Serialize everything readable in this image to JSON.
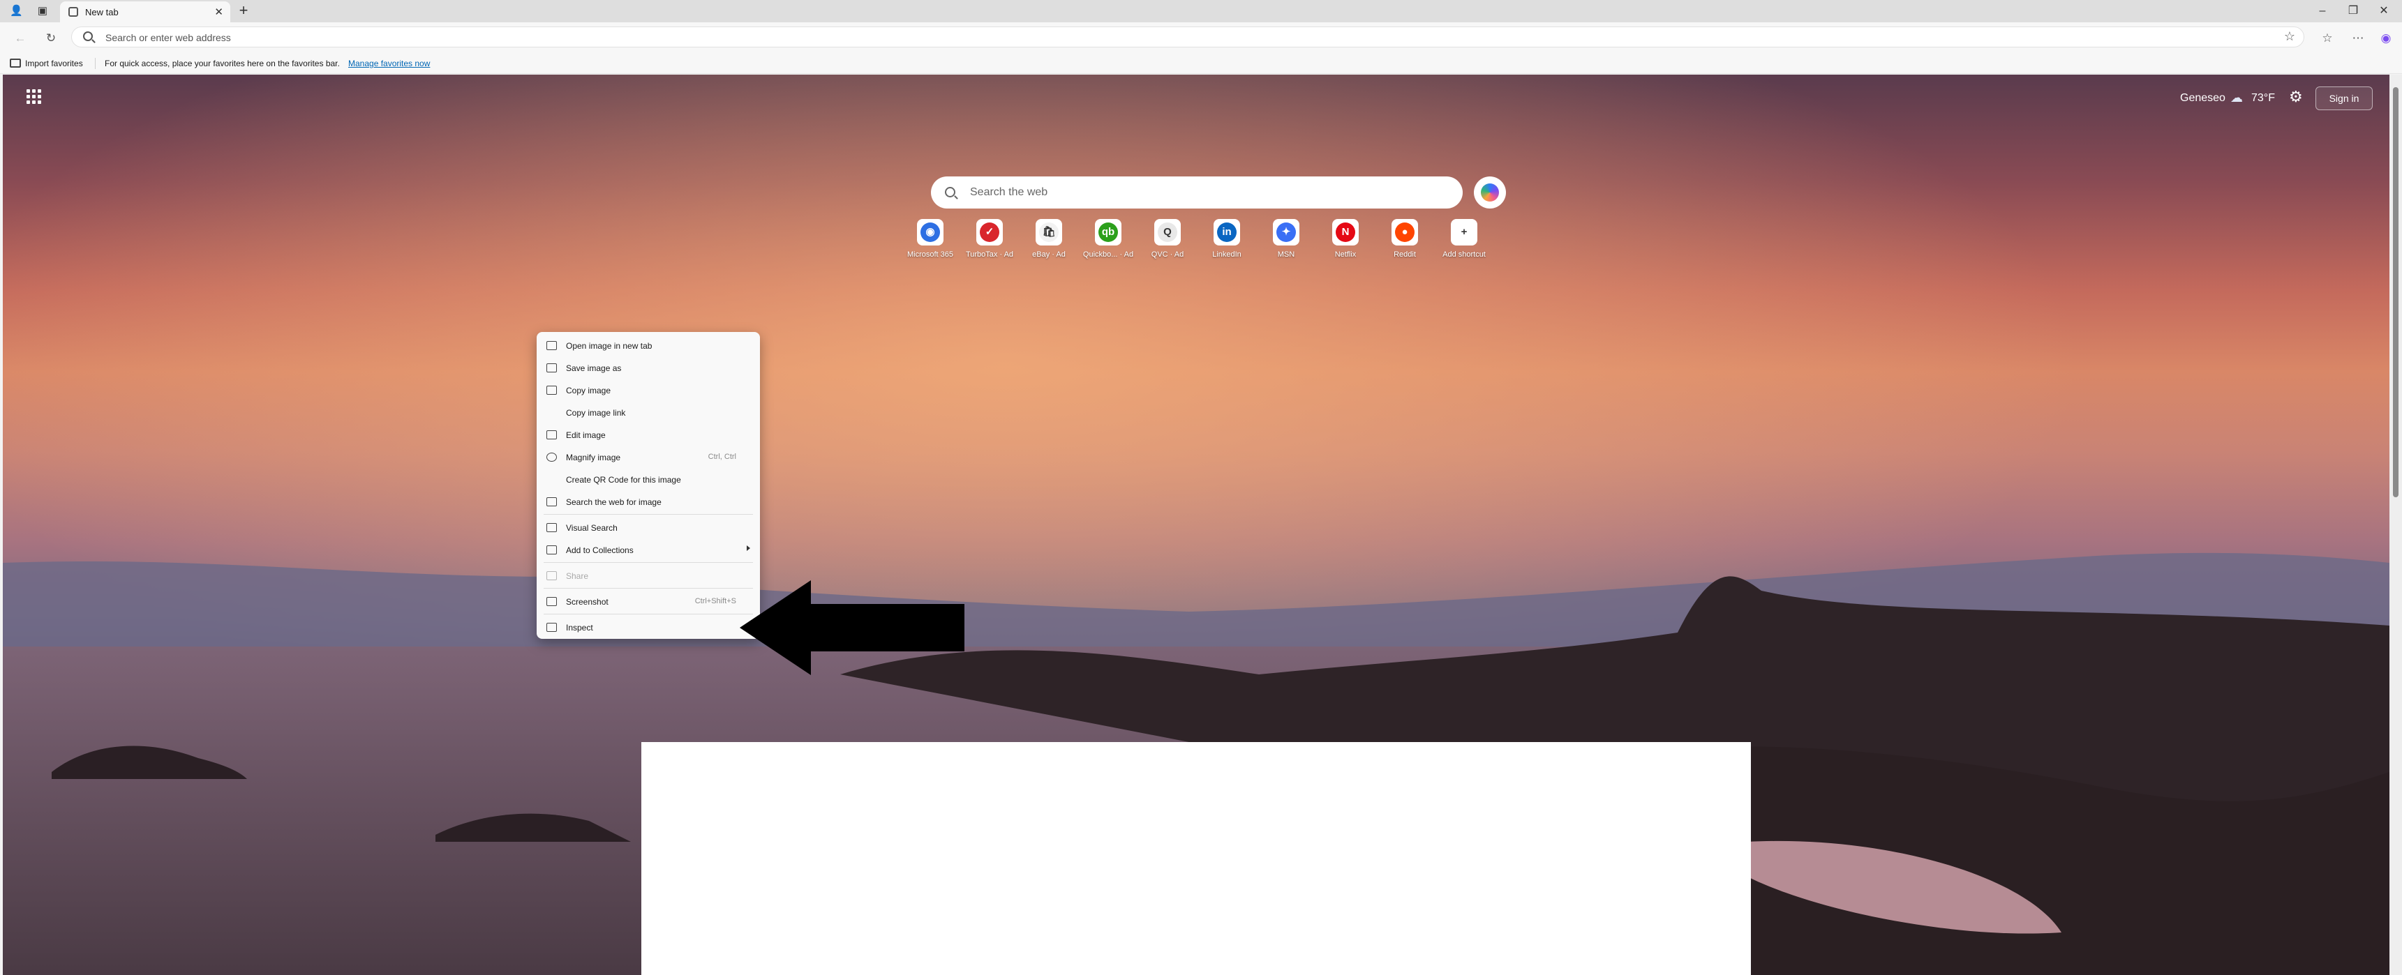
{
  "browser": {
    "tab_title": "New tab",
    "address_placeholder": "Search or enter web address"
  },
  "favorites_bar": {
    "import_label": "Import favorites",
    "hint": "For quick access, place your favorites here on the favorites bar.",
    "manage_link": "Manage favorites now"
  },
  "header": {
    "location": "Geneseo",
    "temperature": "73°F",
    "weather_icon": "partly-cloudy-icon",
    "signin_label": "Sign in"
  },
  "search": {
    "placeholder": "Search the web"
  },
  "quick_links": [
    {
      "label": "Microsoft 365",
      "glyph": "◉",
      "color": "#2d6fe3"
    },
    {
      "label": "TurboTax · Ad",
      "glyph": "✓",
      "color": "#d9262c"
    },
    {
      "label": "eBay · Ad",
      "glyph": "🛍",
      "color": "#f2f2f2"
    },
    {
      "label": "Quickbo... · Ad",
      "glyph": "qb",
      "color": "#2ca01c"
    },
    {
      "label": "QVC · Ad",
      "glyph": "Q",
      "color": "#e8e8e8"
    },
    {
      "label": "LinkedIn",
      "glyph": "in",
      "color": "#0a66c2"
    },
    {
      "label": "MSN",
      "glyph": "✦",
      "color": "#3a6ff5"
    },
    {
      "label": "Netflix",
      "glyph": "N",
      "color": "#e50914"
    },
    {
      "label": "Reddit",
      "glyph": "●",
      "color": "#ff4500"
    },
    {
      "label": "Add shortcut",
      "glyph": "+",
      "color": "#ffffff"
    }
  ],
  "context_menu": {
    "items": [
      {
        "label": "Open image in new tab",
        "shortcut": ""
      },
      {
        "label": "Save image as",
        "shortcut": ""
      },
      {
        "label": "Copy image",
        "shortcut": ""
      },
      {
        "label": "Copy image link",
        "shortcut": ""
      },
      {
        "label": "Edit image",
        "shortcut": ""
      },
      {
        "label": "Magnify image",
        "shortcut": "Ctrl, Ctrl"
      },
      {
        "label": "Create QR Code for this image",
        "shortcut": ""
      },
      {
        "label": "Search the web for image",
        "shortcut": ""
      },
      {
        "label": "Visual Search",
        "shortcut": ""
      },
      {
        "label": "Add to Collections",
        "shortcut": ""
      },
      {
        "label": "Share",
        "shortcut": ""
      },
      {
        "label": "Screenshot",
        "shortcut": "Ctrl+Shift+S"
      },
      {
        "label": "Inspect",
        "shortcut": ""
      }
    ]
  }
}
